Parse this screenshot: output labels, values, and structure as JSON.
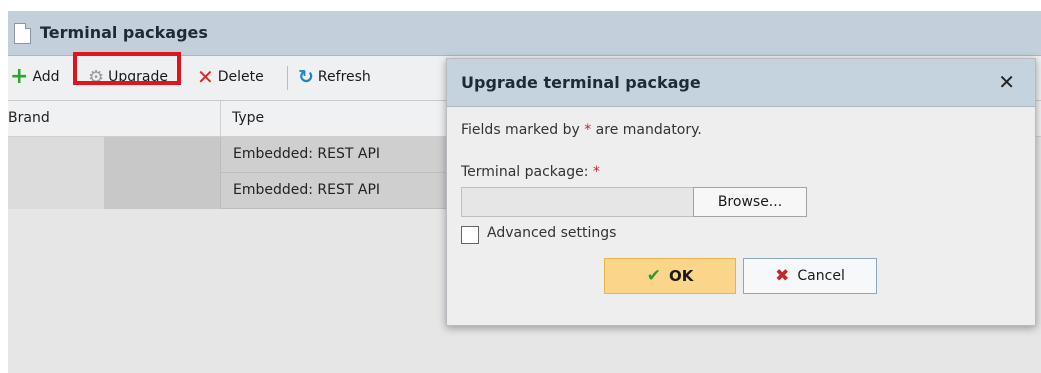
{
  "panel": {
    "title": "Terminal packages",
    "icons": {
      "title": "document-icon"
    }
  },
  "toolbar": {
    "add_label": "Add",
    "upgrade_label": "Upgrade",
    "delete_label": "Delete",
    "refresh_label": "Refresh",
    "icons": {
      "add": "plus-icon",
      "upgrade": "gear-icon",
      "delete": "x-icon",
      "refresh": "refresh-icon"
    },
    "highlight_color": "#e0141e"
  },
  "grid": {
    "columns": [
      "Brand",
      "Type"
    ],
    "rows": [
      {
        "brand": "",
        "type": "Embedded: REST API"
      },
      {
        "brand": "",
        "type": "Embedded: REST API"
      }
    ]
  },
  "dialog": {
    "title": "Upgrade terminal package",
    "close_glyph": "✕",
    "note_prefix": "Fields marked by ",
    "note_star": "*",
    "note_suffix": " are mandatory.",
    "field_label": "Terminal package: ",
    "field_star": "*",
    "file_value": "",
    "browse_label": "Browse...",
    "advanced_label": "Advanced settings",
    "advanced_checked": false,
    "ok_label": "OK",
    "cancel_label": "Cancel",
    "icons": {
      "ok": "checkmark-icon",
      "cancel": "x-icon",
      "close": "close-icon"
    },
    "colors": {
      "ok_bg": "#fbd58a",
      "header_bg": "#c5d3df",
      "required": "#c0282e"
    }
  }
}
